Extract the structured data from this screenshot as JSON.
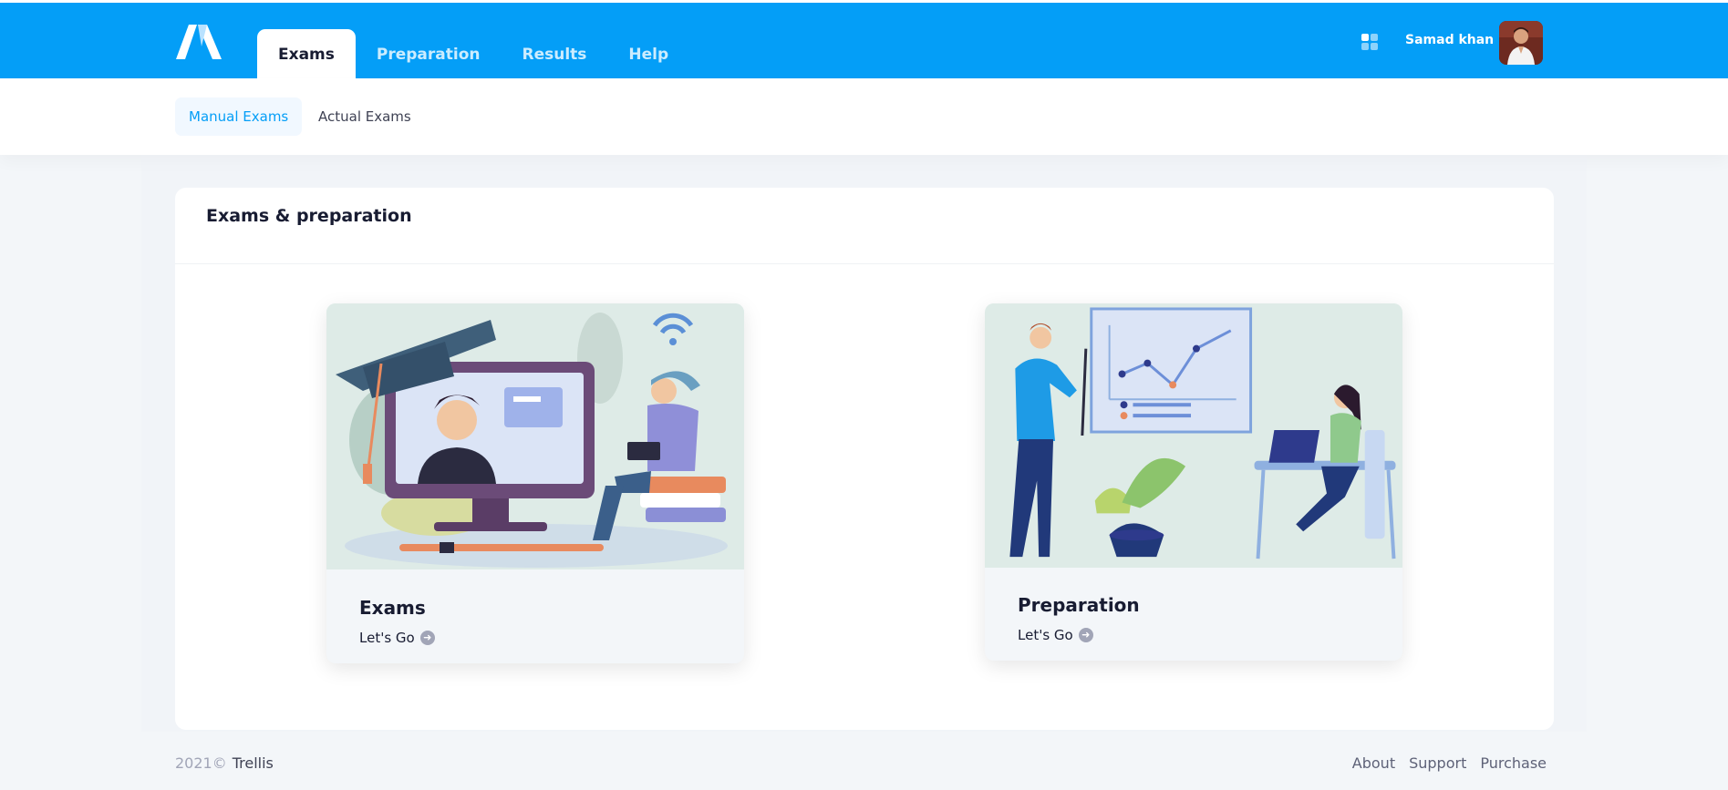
{
  "nav": {
    "items": [
      {
        "label": "Exams",
        "active": true
      },
      {
        "label": "Preparation",
        "active": false
      },
      {
        "label": "Results",
        "active": false
      },
      {
        "label": "Help",
        "active": false
      }
    ]
  },
  "user": {
    "name": "Samad khan"
  },
  "subnav": {
    "items": [
      {
        "label": "Manual Exams",
        "active": true
      },
      {
        "label": "Actual Exams",
        "active": false
      }
    ]
  },
  "main": {
    "title": "Exams & preparation",
    "tiles": [
      {
        "title": "Exams",
        "link": "Let's Go"
      },
      {
        "title": "Preparation",
        "link": "Let's Go"
      }
    ]
  },
  "footer": {
    "year": "2021©",
    "brand": "Trellis",
    "links": [
      "About",
      "Support",
      "Purchase"
    ]
  },
  "colors": {
    "primary": "#049ef7",
    "accent_orange": "#e88a5e"
  },
  "icons": {
    "apps": "apps-grid-icon",
    "go": "arrow-circle-right-icon"
  }
}
